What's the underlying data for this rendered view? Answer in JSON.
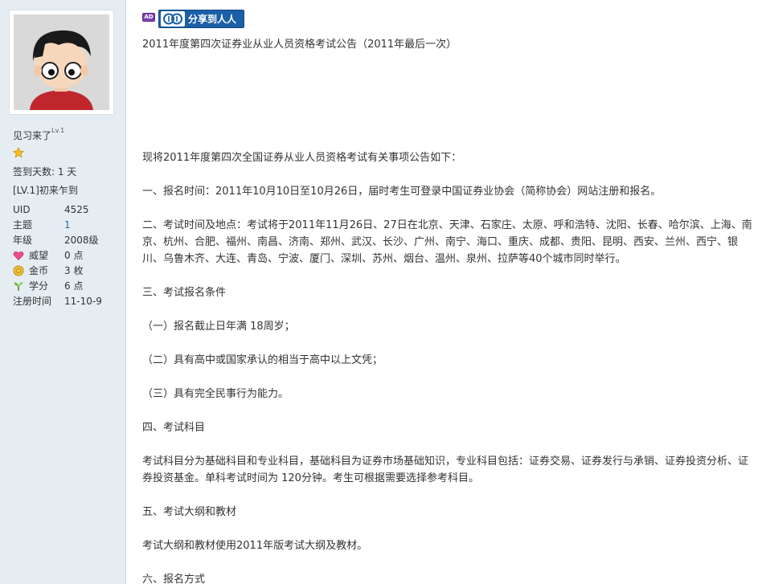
{
  "sidebar": {
    "username": "见习来了",
    "level_badge": "Lv.1",
    "signin_days": "签到天数: 1 天",
    "level_title": "[LV.1]初来乍到",
    "stats": [
      {
        "key": "UID",
        "value": "4525",
        "icon": "",
        "link": false
      },
      {
        "key": "主题",
        "value": "1",
        "icon": "",
        "link": true
      },
      {
        "key": "年级",
        "value": "2008级",
        "icon": "",
        "link": false
      },
      {
        "key": "威望",
        "value": "0 点",
        "icon": "heart-icon",
        "link": false
      },
      {
        "key": "金币",
        "value": "3 枚",
        "icon": "coin-icon",
        "link": false
      },
      {
        "key": "学分",
        "value": "6 点",
        "icon": "sprout-icon",
        "link": false
      },
      {
        "key": "注册时间",
        "value": "11-10-9",
        "icon": "",
        "link": false
      }
    ]
  },
  "toolbar": {
    "ad_label": "AD",
    "share_label": "分享到人人"
  },
  "post": {
    "title": "2011年度第四次证券业从业人员资格考试公告（2011年最后一次）",
    "paragraphs": [
      "现将2011年度第四次全国证券从业人员资格考试有关事项公告如下：",
      "一、报名时间：2011年10月10日至10月26日，届时考生可登录中国证券业协会（简称协会）网站注册和报名。",
      "二、考试时间及地点：考试将于2011年11月26日、27日在北京、天津、石家庄、太原、呼和浩特、沈阳、长春、哈尔滨、上海、南京、杭州、合肥、福州、南昌、济南、郑州、武汉、长沙、广州、南宁、海口、重庆、成都、贵阳、昆明、西安、兰州、西宁、银川、乌鲁木齐、大连、青岛、宁波、厦门、深圳、苏州、烟台、温州、泉州、拉萨等40个城市同时举行。",
      "三、考试报名条件",
      "（一）报名截止日年满 18周岁；",
      "（二）具有高中或国家承认的相当于高中以上文凭；",
      "（三）具有完全民事行为能力。",
      "四、考试科目",
      "考试科目分为基础科目和专业科目，基础科目为证券市场基础知识，专业科目包括：证券交易、证券发行与承销、证券投资分析、证券投资基金。单科考试时间为 120分钟。考生可根据需要选择参考科目。",
      "五、考试大纲和教材",
      "考试大纲和教材使用2011年版考试大纲及教材。",
      "六、报名方式"
    ]
  },
  "colors": {
    "sidebar_bg": "#e5edf2",
    "share_blue": "#1b5fa8",
    "link_blue": "#336699"
  }
}
